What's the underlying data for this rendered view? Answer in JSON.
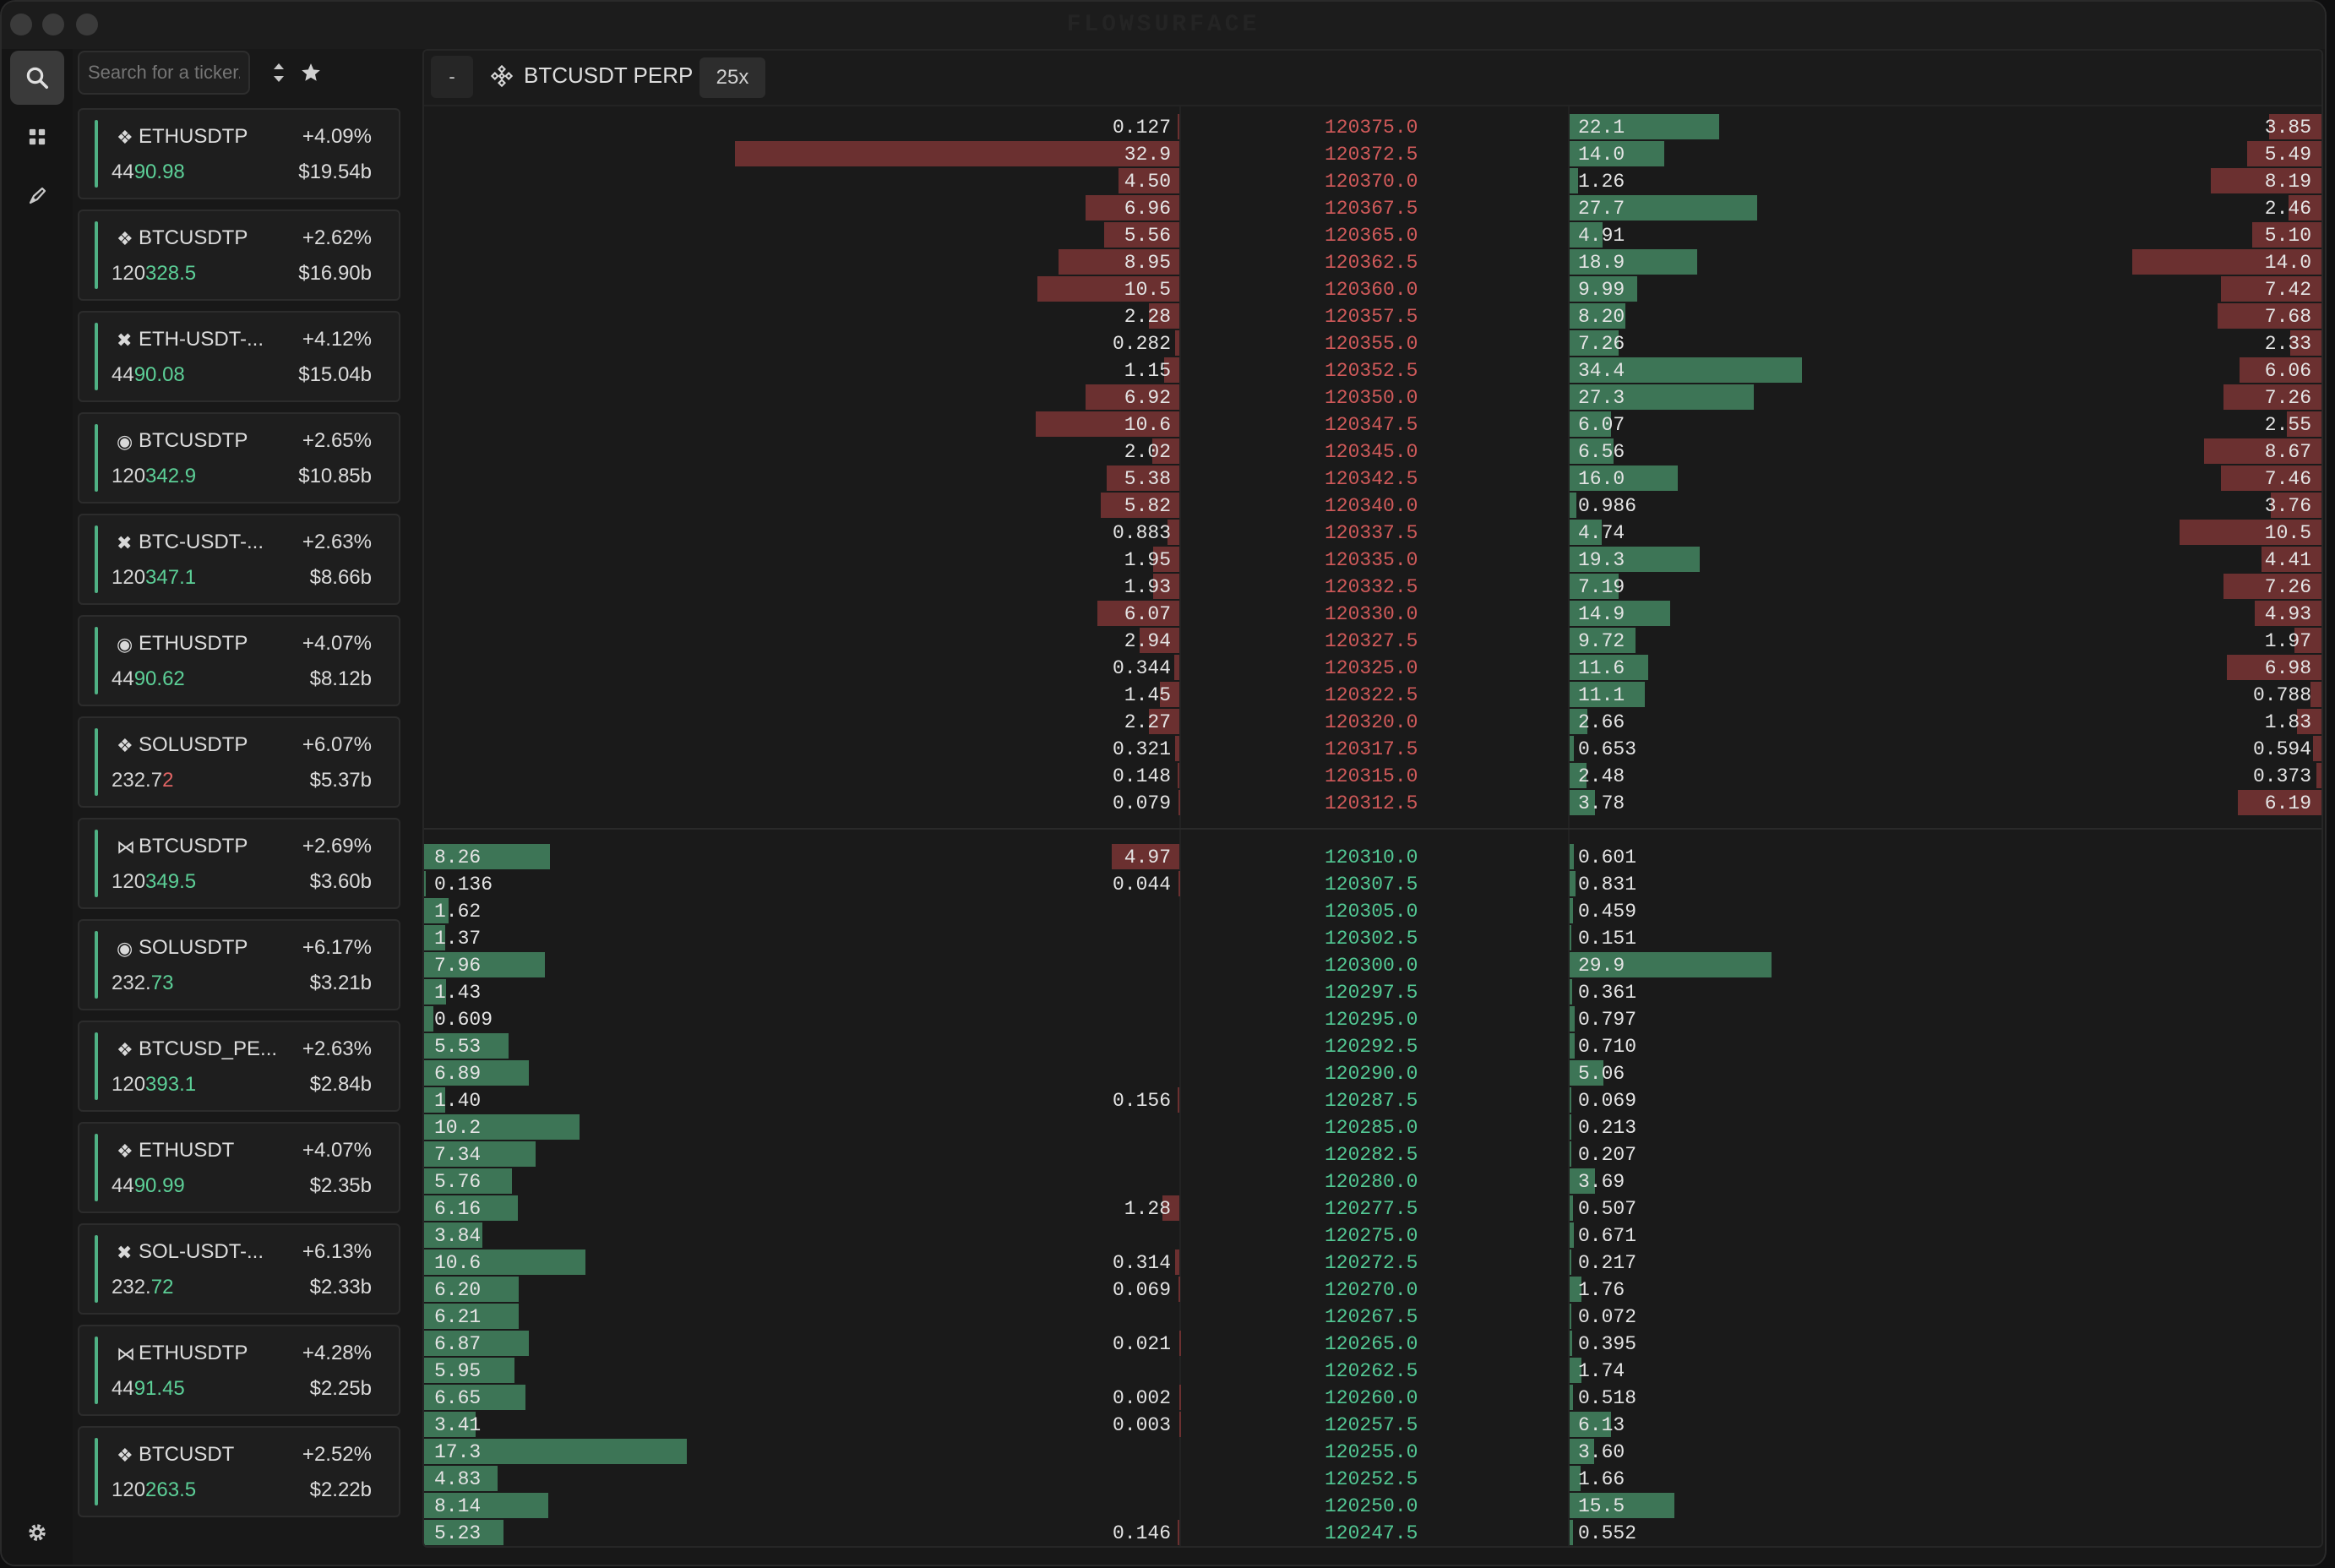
{
  "window": {
    "title": "FLOWSURFACE"
  },
  "search": {
    "placeholder": "Search for a ticker..."
  },
  "tickers": [
    {
      "exchange_icon": "binance-icon",
      "symbol": "ETHUSDTP",
      "change": "+4.09%",
      "price_prefix": "44",
      "price_hl": "90.98",
      "direction": "up",
      "volume": "$19.54b"
    },
    {
      "exchange_icon": "binance-icon",
      "symbol": "BTCUSDTP",
      "change": "+2.62%",
      "price_prefix": "120",
      "price_hl": "328.5",
      "direction": "up",
      "volume": "$16.90b"
    },
    {
      "exchange_icon": "okx-icon",
      "symbol": "ETH-USDT-...",
      "change": "+4.12%",
      "price_prefix": "44",
      "price_hl": "90.08",
      "direction": "up",
      "volume": "$15.04b"
    },
    {
      "exchange_icon": "bybit-icon",
      "symbol": "BTCUSDTP",
      "change": "+2.65%",
      "price_prefix": "120",
      "price_hl": "342.9",
      "direction": "up",
      "volume": "$10.85b"
    },
    {
      "exchange_icon": "okx-icon",
      "symbol": "BTC-USDT-...",
      "change": "+2.63%",
      "price_prefix": "120",
      "price_hl": "347.1",
      "direction": "up",
      "volume": "$8.66b"
    },
    {
      "exchange_icon": "bybit-icon",
      "symbol": "ETHUSDTP",
      "change": "+4.07%",
      "price_prefix": "44",
      "price_hl": "90.62",
      "direction": "up",
      "volume": "$8.12b"
    },
    {
      "exchange_icon": "binance-icon",
      "symbol": "SOLUSDTP",
      "change": "+6.07%",
      "price_prefix": "232.7",
      "price_hl": "2",
      "direction": "down",
      "volume": "$5.37b"
    },
    {
      "exchange_icon": "hyperliquid-icon",
      "symbol": "BTCUSDTP",
      "change": "+2.69%",
      "price_prefix": "120",
      "price_hl": "349.5",
      "direction": "up",
      "volume": "$3.60b"
    },
    {
      "exchange_icon": "bybit-icon",
      "symbol": "SOLUSDTP",
      "change": "+6.17%",
      "price_prefix": "232.",
      "price_hl": "73",
      "direction": "up",
      "volume": "$3.21b"
    },
    {
      "exchange_icon": "binance-icon",
      "symbol": "BTCUSD_PE...",
      "change": "+2.63%",
      "price_prefix": "120",
      "price_hl": "393.1",
      "direction": "up",
      "volume": "$2.84b"
    },
    {
      "exchange_icon": "binance-icon",
      "symbol": "ETHUSDT",
      "change": "+4.07%",
      "price_prefix": "44",
      "price_hl": "90.99",
      "direction": "up",
      "volume": "$2.35b"
    },
    {
      "exchange_icon": "okx-icon",
      "symbol": "SOL-USDT-...",
      "change": "+6.13%",
      "price_prefix": "232.",
      "price_hl": "72",
      "direction": "up",
      "volume": "$2.33b"
    },
    {
      "exchange_icon": "hyperliquid-icon",
      "symbol": "ETHUSDTP",
      "change": "+4.28%",
      "price_prefix": "44",
      "price_hl": "91.45",
      "direction": "up",
      "volume": "$2.25b"
    },
    {
      "exchange_icon": "binance-icon",
      "symbol": "BTCUSDT",
      "change": "+2.52%",
      "price_prefix": "120",
      "price_hl": "263.5",
      "direction": "up",
      "volume": "$2.22b"
    }
  ],
  "panel": {
    "collapse_label": "-",
    "title": "BTCUSDT PERP",
    "leverage": "25x"
  },
  "orderbook": {
    "asks": [
      {
        "price": "120375.0",
        "c1": "",
        "c2": "0.127",
        "c3": "22.1",
        "c4": "3.85"
      },
      {
        "price": "120372.5",
        "c1": "",
        "c2": "32.9",
        "c3": "14.0",
        "c4": "5.49"
      },
      {
        "price": "120370.0",
        "c1": "",
        "c2": "4.50",
        "c3": "1.26",
        "c4": "8.19"
      },
      {
        "price": "120367.5",
        "c1": "",
        "c2": "6.96",
        "c3": "27.7",
        "c4": "2.46"
      },
      {
        "price": "120365.0",
        "c1": "",
        "c2": "5.56",
        "c3": "4.91",
        "c4": "5.10"
      },
      {
        "price": "120362.5",
        "c1": "",
        "c2": "8.95",
        "c3": "18.9",
        "c4": "14.0"
      },
      {
        "price": "120360.0",
        "c1": "",
        "c2": "10.5",
        "c3": "9.99",
        "c4": "7.42"
      },
      {
        "price": "120357.5",
        "c1": "",
        "c2": "2.28",
        "c3": "8.20",
        "c4": "7.68"
      },
      {
        "price": "120355.0",
        "c1": "",
        "c2": "0.282",
        "c3": "7.26",
        "c4": "2.33"
      },
      {
        "price": "120352.5",
        "c1": "",
        "c2": "1.15",
        "c3": "34.4",
        "c4": "6.06"
      },
      {
        "price": "120350.0",
        "c1": "",
        "c2": "6.92",
        "c3": "27.3",
        "c4": "7.26"
      },
      {
        "price": "120347.5",
        "c1": "",
        "c2": "10.6",
        "c3": "6.07",
        "c4": "2.55"
      },
      {
        "price": "120345.0",
        "c1": "",
        "c2": "2.02",
        "c3": "6.56",
        "c4": "8.67"
      },
      {
        "price": "120342.5",
        "c1": "",
        "c2": "5.38",
        "c3": "16.0",
        "c4": "7.46"
      },
      {
        "price": "120340.0",
        "c1": "",
        "c2": "5.82",
        "c3": "0.986",
        "c4": "3.76"
      },
      {
        "price": "120337.5",
        "c1": "",
        "c2": "0.883",
        "c3": "4.74",
        "c4": "10.5"
      },
      {
        "price": "120335.0",
        "c1": "",
        "c2": "1.95",
        "c3": "19.3",
        "c4": "4.41"
      },
      {
        "price": "120332.5",
        "c1": "",
        "c2": "1.93",
        "c3": "7.19",
        "c4": "7.26"
      },
      {
        "price": "120330.0",
        "c1": "",
        "c2": "6.07",
        "c3": "14.9",
        "c4": "4.93"
      },
      {
        "price": "120327.5",
        "c1": "",
        "c2": "2.94",
        "c3": "9.72",
        "c4": "1.97"
      },
      {
        "price": "120325.0",
        "c1": "",
        "c2": "0.344",
        "c3": "11.6",
        "c4": "6.98"
      },
      {
        "price": "120322.5",
        "c1": "",
        "c2": "1.45",
        "c3": "11.1",
        "c4": "0.788"
      },
      {
        "price": "120320.0",
        "c1": "",
        "c2": "2.27",
        "c3": "2.66",
        "c4": "1.83"
      },
      {
        "price": "120317.5",
        "c1": "",
        "c2": "0.321",
        "c3": "0.653",
        "c4": "0.594"
      },
      {
        "price": "120315.0",
        "c1": "",
        "c2": "0.148",
        "c3": "2.48",
        "c4": "0.373"
      },
      {
        "price": "120312.5",
        "c1": "",
        "c2": "0.079",
        "c3": "3.78",
        "c4": "6.19"
      }
    ],
    "bids": [
      {
        "price": "120310.0",
        "c1": "8.26",
        "c2": "4.97",
        "c3": "0.601",
        "c4": ""
      },
      {
        "price": "120307.5",
        "c1": "0.136",
        "c2": "0.044",
        "c3": "0.831",
        "c4": ""
      },
      {
        "price": "120305.0",
        "c1": "1.62",
        "c2": "",
        "c3": "0.459",
        "c4": ""
      },
      {
        "price": "120302.5",
        "c1": "1.37",
        "c2": "",
        "c3": "0.151",
        "c4": ""
      },
      {
        "price": "120300.0",
        "c1": "7.96",
        "c2": "",
        "c3": "29.9",
        "c4": ""
      },
      {
        "price": "120297.5",
        "c1": "1.43",
        "c2": "",
        "c3": "0.361",
        "c4": ""
      },
      {
        "price": "120295.0",
        "c1": "0.609",
        "c2": "",
        "c3": "0.797",
        "c4": ""
      },
      {
        "price": "120292.5",
        "c1": "5.53",
        "c2": "",
        "c3": "0.710",
        "c4": ""
      },
      {
        "price": "120290.0",
        "c1": "6.89",
        "c2": "",
        "c3": "5.06",
        "c4": ""
      },
      {
        "price": "120287.5",
        "c1": "1.40",
        "c2": "0.156",
        "c3": "0.069",
        "c4": ""
      },
      {
        "price": "120285.0",
        "c1": "10.2",
        "c2": "",
        "c3": "0.213",
        "c4": ""
      },
      {
        "price": "120282.5",
        "c1": "7.34",
        "c2": "",
        "c3": "0.207",
        "c4": ""
      },
      {
        "price": "120280.0",
        "c1": "5.76",
        "c2": "",
        "c3": "3.69",
        "c4": ""
      },
      {
        "price": "120277.5",
        "c1": "6.16",
        "c2": "1.28",
        "c3": "0.507",
        "c4": ""
      },
      {
        "price": "120275.0",
        "c1": "3.84",
        "c2": "",
        "c3": "0.671",
        "c4": ""
      },
      {
        "price": "120272.5",
        "c1": "10.6",
        "c2": "0.314",
        "c3": "0.217",
        "c4": ""
      },
      {
        "price": "120270.0",
        "c1": "6.20",
        "c2": "0.069",
        "c3": "1.76",
        "c4": ""
      },
      {
        "price": "120267.5",
        "c1": "6.21",
        "c2": "",
        "c3": "0.072",
        "c4": ""
      },
      {
        "price": "120265.0",
        "c1": "6.87",
        "c2": "0.021",
        "c3": "0.395",
        "c4": ""
      },
      {
        "price": "120262.5",
        "c1": "5.95",
        "c2": "",
        "c3": "1.74",
        "c4": ""
      },
      {
        "price": "120260.0",
        "c1": "6.65",
        "c2": "0.002",
        "c3": "0.518",
        "c4": ""
      },
      {
        "price": "120257.5",
        "c1": "3.41",
        "c2": "0.003",
        "c3": "6.13",
        "c4": ""
      },
      {
        "price": "120255.0",
        "c1": "17.3",
        "c2": "",
        "c3": "3.60",
        "c4": ""
      },
      {
        "price": "120252.5",
        "c1": "4.83",
        "c2": "",
        "c3": "1.66",
        "c4": ""
      },
      {
        "price": "120250.0",
        "c1": "8.14",
        "c2": "",
        "c3": "15.5",
        "c4": ""
      },
      {
        "price": "120247.5",
        "c1": "5.23",
        "c2": "0.146",
        "c3": "0.552",
        "c4": ""
      }
    ]
  },
  "colors": {
    "bid": "#3d7556",
    "ask": "#6b3030",
    "price_up": "#5ccf97",
    "price_down": "#e06464"
  }
}
